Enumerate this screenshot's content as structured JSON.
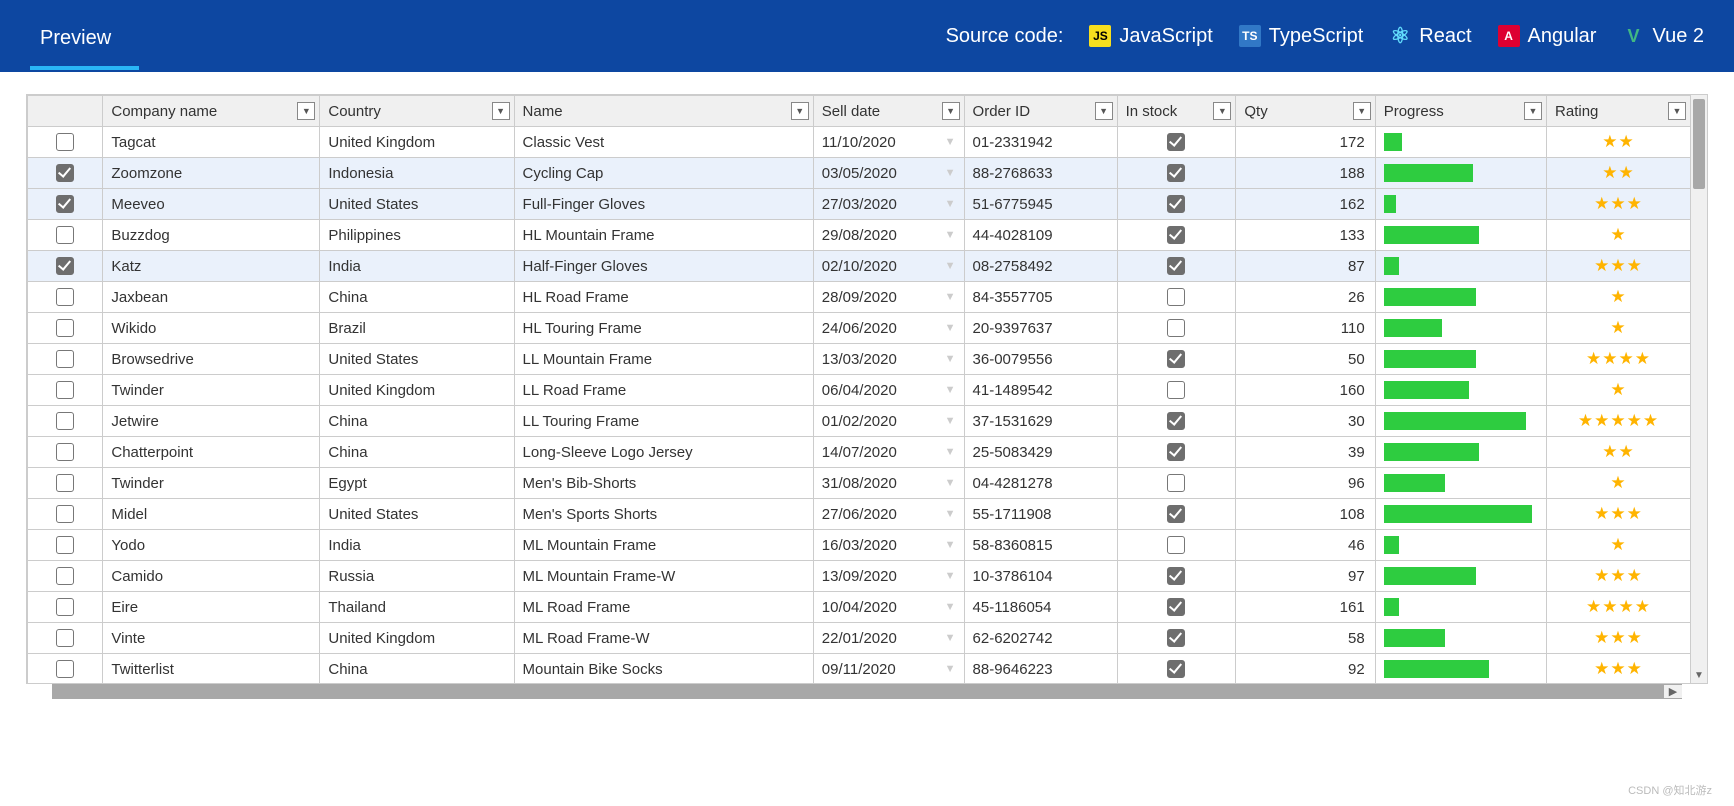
{
  "topbar": {
    "preview_label": "Preview",
    "source_label": "Source code:",
    "langs": {
      "js": "JavaScript",
      "ts": "TypeScript",
      "react": "React",
      "angular": "Angular",
      "vue": "Vue 2"
    }
  },
  "columns": {
    "company": "Company name",
    "country": "Country",
    "name": "Name",
    "sell_date": "Sell date",
    "order_id": "Order ID",
    "in_stock": "In stock",
    "qty": "Qty",
    "progress": "Progress",
    "rating": "Rating"
  },
  "rows": [
    {
      "selected": false,
      "company": "Tagcat",
      "country": "United Kingdom",
      "name": "Classic Vest",
      "date": "11/10/2020",
      "order": "01-2331942",
      "in_stock": true,
      "qty": 172,
      "progress": 12,
      "rating": 2
    },
    {
      "selected": true,
      "company": "Zoomzone",
      "country": "Indonesia",
      "name": "Cycling Cap",
      "date": "03/05/2020",
      "order": "88-2768633",
      "in_stock": true,
      "qty": 188,
      "progress": 58,
      "rating": 2
    },
    {
      "selected": true,
      "company": "Meeveo",
      "country": "United States",
      "name": "Full-Finger Gloves",
      "date": "27/03/2020",
      "order": "51-6775945",
      "in_stock": true,
      "qty": 162,
      "progress": 8,
      "rating": 3
    },
    {
      "selected": false,
      "company": "Buzzdog",
      "country": "Philippines",
      "name": "HL Mountain Frame",
      "date": "29/08/2020",
      "order": "44-4028109",
      "in_stock": true,
      "qty": 133,
      "progress": 62,
      "rating": 1
    },
    {
      "selected": true,
      "company": "Katz",
      "country": "India",
      "name": "Half-Finger Gloves",
      "date": "02/10/2020",
      "order": "08-2758492",
      "in_stock": true,
      "qty": 87,
      "progress": 10,
      "rating": 3
    },
    {
      "selected": false,
      "company": "Jaxbean",
      "country": "China",
      "name": "HL Road Frame",
      "date": "28/09/2020",
      "order": "84-3557705",
      "in_stock": false,
      "qty": 26,
      "progress": 60,
      "rating": 1
    },
    {
      "selected": false,
      "company": "Wikido",
      "country": "Brazil",
      "name": "HL Touring Frame",
      "date": "24/06/2020",
      "order": "20-9397637",
      "in_stock": false,
      "qty": 110,
      "progress": 38,
      "rating": 1
    },
    {
      "selected": false,
      "company": "Browsedrive",
      "country": "United States",
      "name": "LL Mountain Frame",
      "date": "13/03/2020",
      "order": "36-0079556",
      "in_stock": true,
      "qty": 50,
      "progress": 60,
      "rating": 4
    },
    {
      "selected": false,
      "company": "Twinder",
      "country": "United Kingdom",
      "name": "LL Road Frame",
      "date": "06/04/2020",
      "order": "41-1489542",
      "in_stock": false,
      "qty": 160,
      "progress": 55,
      "rating": 1
    },
    {
      "selected": false,
      "company": "Jetwire",
      "country": "China",
      "name": "LL Touring Frame",
      "date": "01/02/2020",
      "order": "37-1531629",
      "in_stock": true,
      "qty": 30,
      "progress": 92,
      "rating": 5
    },
    {
      "selected": false,
      "company": "Chatterpoint",
      "country": "China",
      "name": "Long-Sleeve Logo Jersey",
      "date": "14/07/2020",
      "order": "25-5083429",
      "in_stock": true,
      "qty": 39,
      "progress": 62,
      "rating": 2
    },
    {
      "selected": false,
      "company": "Twinder",
      "country": "Egypt",
      "name": "Men's Bib-Shorts",
      "date": "31/08/2020",
      "order": "04-4281278",
      "in_stock": false,
      "qty": 96,
      "progress": 40,
      "rating": 1
    },
    {
      "selected": false,
      "company": "Midel",
      "country": "United States",
      "name": "Men's Sports Shorts",
      "date": "27/06/2020",
      "order": "55-1711908",
      "in_stock": true,
      "qty": 108,
      "progress": 96,
      "rating": 3
    },
    {
      "selected": false,
      "company": "Yodo",
      "country": "India",
      "name": "ML Mountain Frame",
      "date": "16/03/2020",
      "order": "58-8360815",
      "in_stock": false,
      "qty": 46,
      "progress": 10,
      "rating": 1
    },
    {
      "selected": false,
      "company": "Camido",
      "country": "Russia",
      "name": "ML Mountain Frame-W",
      "date": "13/09/2020",
      "order": "10-3786104",
      "in_stock": true,
      "qty": 97,
      "progress": 60,
      "rating": 3
    },
    {
      "selected": false,
      "company": "Eire",
      "country": "Thailand",
      "name": "ML Road Frame",
      "date": "10/04/2020",
      "order": "45-1186054",
      "in_stock": true,
      "qty": 161,
      "progress": 10,
      "rating": 4
    },
    {
      "selected": false,
      "company": "Vinte",
      "country": "United Kingdom",
      "name": "ML Road Frame-W",
      "date": "22/01/2020",
      "order": "62-6202742",
      "in_stock": true,
      "qty": 58,
      "progress": 40,
      "rating": 3
    },
    {
      "selected": false,
      "company": "Twitterlist",
      "country": "China",
      "name": "Mountain Bike Socks",
      "date": "09/11/2020",
      "order": "88-9646223",
      "in_stock": true,
      "qty": 92,
      "progress": 68,
      "rating": 3
    }
  ],
  "watermark": "CSDN @知北游z"
}
